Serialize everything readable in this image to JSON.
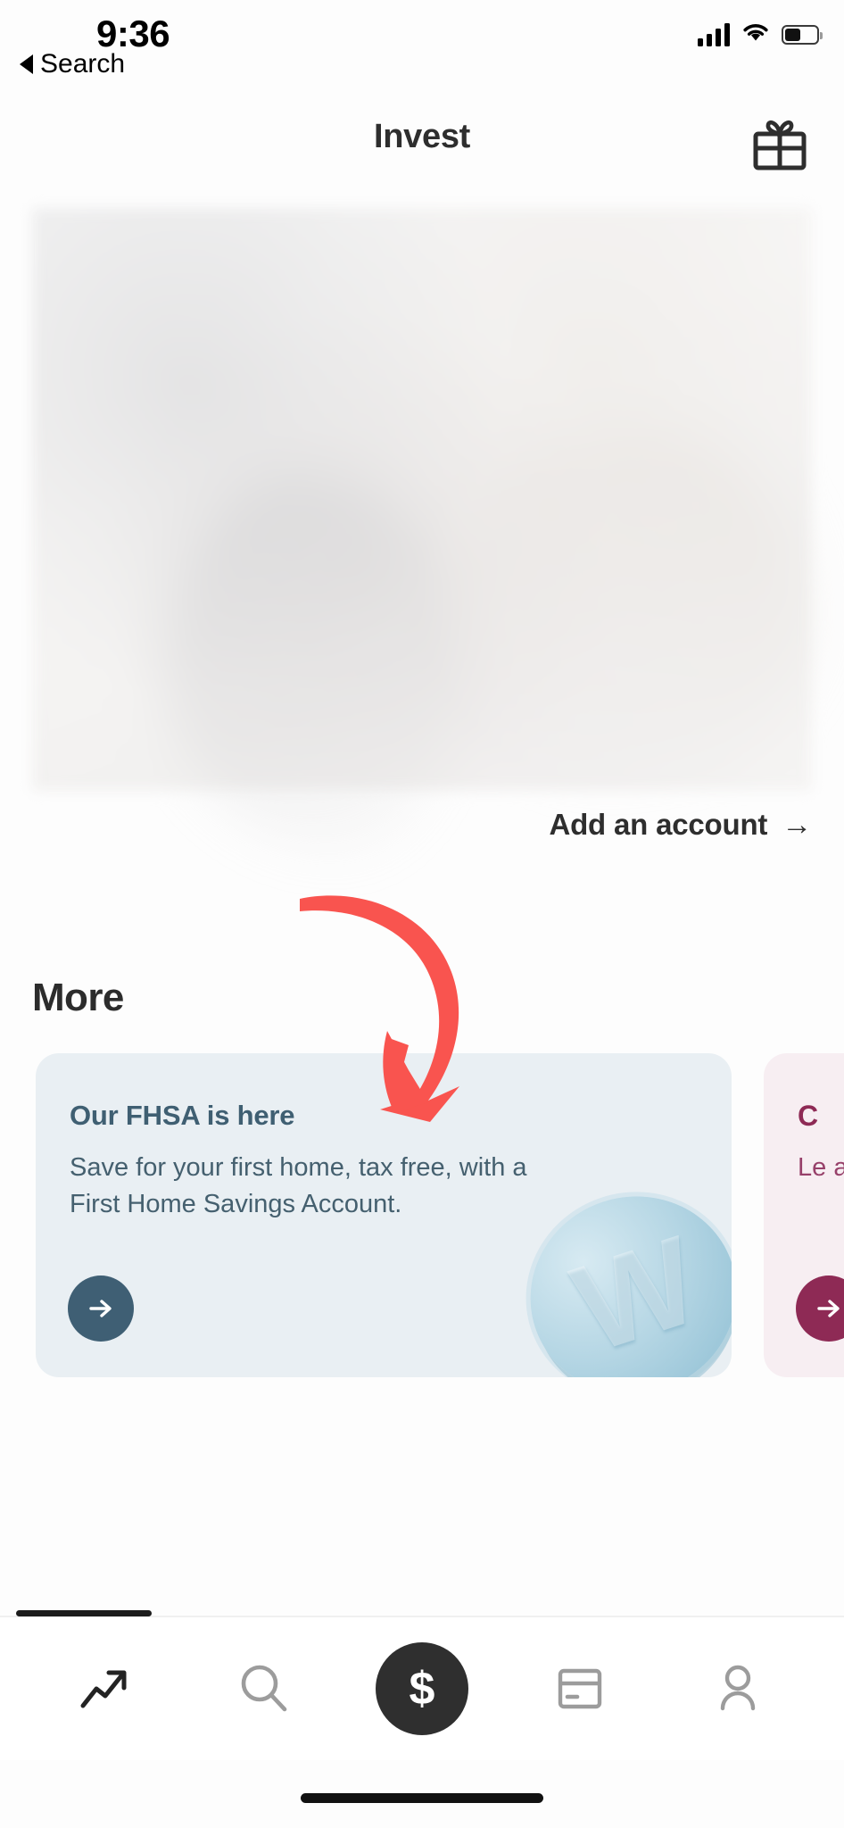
{
  "status_bar": {
    "time": "9:36",
    "back_label": "Search",
    "back_caret_icon": "caret-left-icon",
    "signal_icon": "cellular-signal-icon",
    "wifi_icon": "wifi-icon",
    "battery_icon": "battery-icon",
    "battery_level_percent": 45
  },
  "header": {
    "title": "Invest",
    "gift_icon": "gift-icon"
  },
  "content": {
    "blurred_region_label": "blurred-account-summary",
    "add_account_label": "Add an account",
    "add_account_arrow_icon": "arrow-right-icon"
  },
  "more_section": {
    "heading": "More",
    "cards": [
      {
        "title": "Our FHSA is here",
        "body": "Save for your first home, tax free, with a First Home Savings Account.",
        "cta_icon": "arrow-right-icon",
        "artwork": "wealthsimple-coin-graphic",
        "artwork_glyph": "W",
        "background_color": "#e9eff3",
        "text_color": "#3f5f72",
        "cta_color": "#3f5f74"
      },
      {
        "title": "C",
        "body": "Le\na\na",
        "cta_icon": "arrow-right-icon",
        "background_color": "#f7eef2",
        "text_color": "#8e2a55",
        "cta_color": "#8e2a55"
      }
    ]
  },
  "annotation": {
    "arrow_icon": "curved-arrow-annotation",
    "color": "#f9544f"
  },
  "bottom_nav": {
    "items": [
      {
        "name": "nav-item-grow",
        "icon": "trending-up-icon",
        "active": true
      },
      {
        "name": "nav-item-search",
        "icon": "search-icon",
        "active": false
      },
      {
        "name": "nav-item-cash",
        "icon": "dollar-sign-icon",
        "label": "$",
        "active": true
      },
      {
        "name": "nav-item-card",
        "icon": "credit-card-icon",
        "active": false
      },
      {
        "name": "nav-item-profile",
        "icon": "person-icon",
        "active": false
      }
    ],
    "active_indicator": "tab-indicator"
  },
  "colors": {
    "page_background": "#fdfdfd",
    "accent_red": "#f9544f",
    "nav_active": "#2f2f2f",
    "nav_inactive": "#9c9c9c"
  }
}
